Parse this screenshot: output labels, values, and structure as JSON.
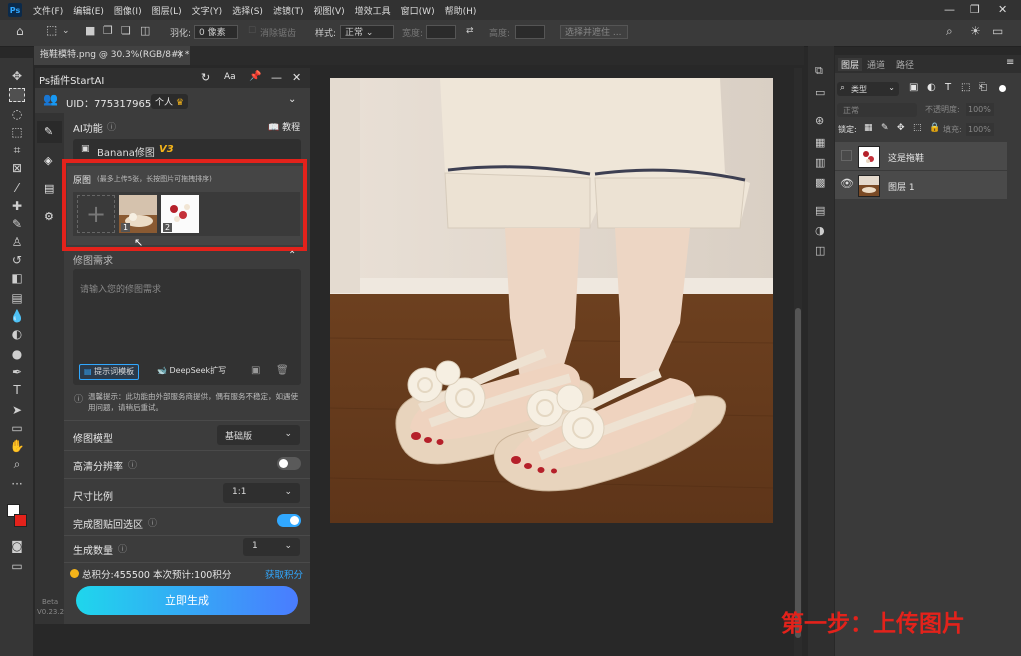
{
  "menu": {
    "logo": "Ps",
    "items": [
      "文件(F)",
      "编辑(E)",
      "图像(I)",
      "图层(L)",
      "文字(Y)",
      "选择(S)",
      "滤镜(T)",
      "视图(V)",
      "增效工具",
      "窗口(W)",
      "帮助(H)"
    ]
  },
  "options_bar": {
    "feather_label": "羽化:",
    "feather_value": "0 像素",
    "antialias_label": "消除锯齿",
    "style_label": "样式:",
    "style_value": "正常",
    "width_label": "宽度:",
    "height_label": "高度:",
    "select_mask_label": "选择并遮住 ..."
  },
  "document_tab": {
    "title": "拖鞋模特.png @ 30.3%(RGB/8#) *"
  },
  "plugin": {
    "title": "Ps插件StartAI",
    "aa": "Aa",
    "uid": "UID：775317965",
    "account_type": "个人",
    "ai_function_label": "AI功能",
    "tutorial_label": "教程",
    "model_select": "Banana修图",
    "model_version": "V3",
    "source_label": "原图",
    "source_hint": "(最多上传5张，长按图片可拖拽排序)",
    "thumb1_index": "1",
    "thumb2_index": "2",
    "edit_req_label": "修图需求",
    "edit_placeholder": "请输入您的修图需求",
    "prompt_template_label": "提示词模板",
    "deepseek_label": "DeepSeek扩写",
    "notice": "温馨提示：此功能由外部服务商提供，偶有服务不稳定，如遇使用问题，请稍后重试。",
    "model_label": "修图模型",
    "model_value": "基础版",
    "hires_label": "高清分辨率",
    "hires_on": false,
    "ratio_label": "尺寸比例",
    "ratio_value": "1:1",
    "paste_back_label": "完成图贴回选区",
    "paste_back_on": true,
    "count_label": "生成数量",
    "count_value": "1",
    "points_text": "总积分:455500  本次预计:100积分",
    "get_points": "获取积分",
    "generate_label": "立即生成",
    "beta": "Beta",
    "version": "V0.23.2"
  },
  "layers_panel": {
    "tabs": [
      "图层",
      "通道",
      "路径"
    ],
    "filter_value": "类型",
    "blend_mode": "正常",
    "opacity_label": "不透明度:",
    "opacity_value": "100%",
    "lock_label": "锁定:",
    "fill_label": "填充:",
    "fill_value": "100%",
    "layers": [
      {
        "name": "这是拖鞋",
        "visible": false
      },
      {
        "name": "图层 1",
        "visible": true
      }
    ]
  },
  "annotation": {
    "text": "第一步：上传图片"
  },
  "colors": {
    "accent_blue": "#31a8ff",
    "highlight_red": "#e3221b",
    "generate_gradient_start": "#1fd6ec",
    "generate_gradient_end": "#4a7cff",
    "points_orange": "#f4b41a"
  }
}
